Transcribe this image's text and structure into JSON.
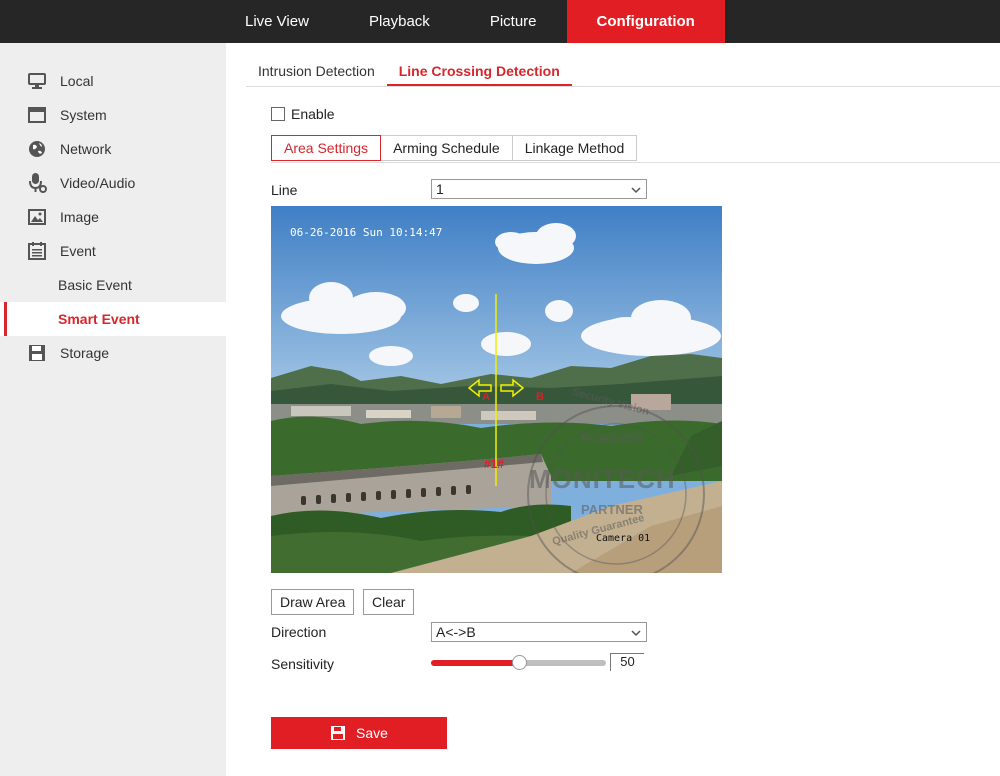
{
  "topnav": {
    "items": [
      {
        "label": "Live View"
      },
      {
        "label": "Playback"
      },
      {
        "label": "Picture"
      },
      {
        "label": "Configuration"
      }
    ],
    "active_color": "#e01e24"
  },
  "sidebar": {
    "items": [
      {
        "label": "Local",
        "icon": "monitor-icon"
      },
      {
        "label": "System",
        "icon": "system-icon"
      },
      {
        "label": "Network",
        "icon": "globe-icon"
      },
      {
        "label": "Video/Audio",
        "icon": "microphone-icon"
      },
      {
        "label": "Image",
        "icon": "image-icon"
      },
      {
        "label": "Event",
        "icon": "calendar-icon"
      },
      {
        "label": "Basic Event"
      },
      {
        "label": "Smart Event"
      },
      {
        "label": "Storage",
        "icon": "floppy-disk-icon"
      }
    ]
  },
  "subtabs": [
    {
      "label": "Intrusion Detection"
    },
    {
      "label": "Line Crossing Detection"
    }
  ],
  "enable": {
    "label": "Enable",
    "checked": false
  },
  "steps": [
    {
      "label": "Area Settings"
    },
    {
      "label": "Arming Schedule"
    },
    {
      "label": "Linkage Method"
    }
  ],
  "line": {
    "label": "Line",
    "value": "1"
  },
  "video": {
    "osd_time": "06-26-2016 Sun 10:14:47",
    "camera_name": "Camera 01",
    "line_marks": {
      "a": "A",
      "b": "B",
      "id": "#1#"
    },
    "watermark": {
      "top": "FOREVER",
      "middle": "MONITECH",
      "bottom": "PARTNER",
      "arc": "Security Vision",
      "arc2": "Quality Guarantee"
    }
  },
  "buttons": {
    "draw_area": "Draw Area",
    "clear": "Clear",
    "save": "Save"
  },
  "direction": {
    "label": "Direction",
    "value": "A<->B"
  },
  "sensitivity": {
    "label": "Sensitivity",
    "value": "50",
    "level_percent": 50
  }
}
